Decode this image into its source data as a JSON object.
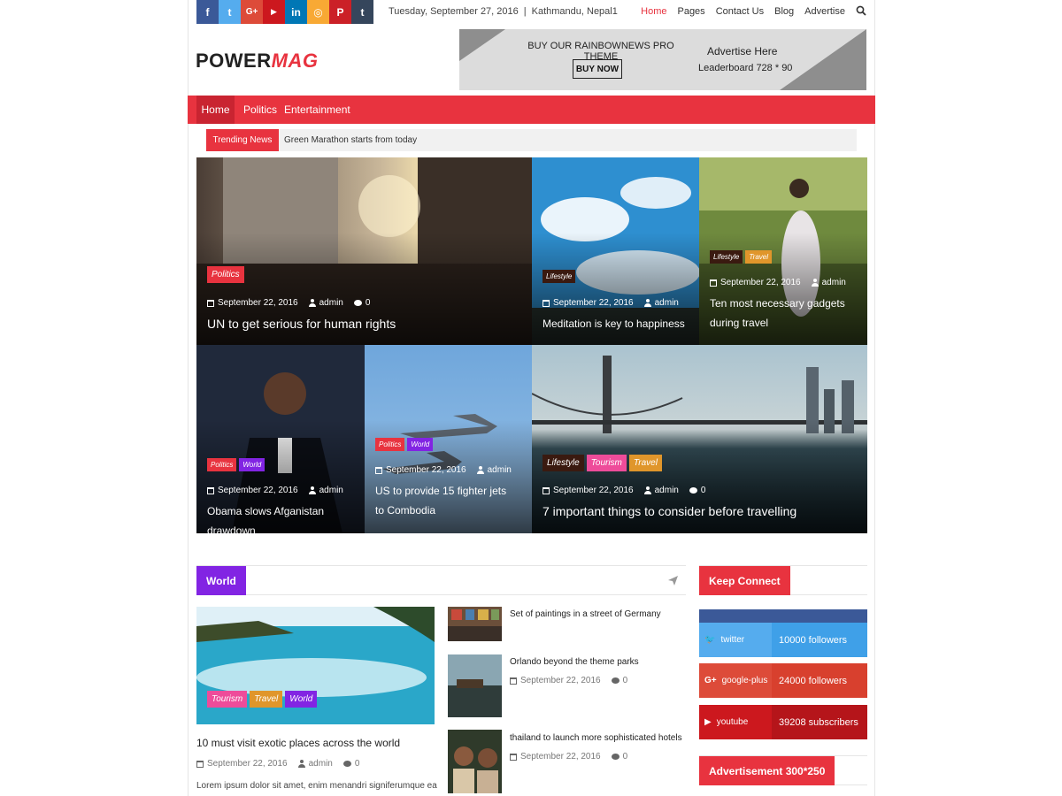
{
  "topbar": {
    "social": [
      "f",
      "t",
      "G+",
      "▶",
      "in",
      "◎",
      "P",
      "t"
    ],
    "social_colors": [
      "#3b5998",
      "#55acee",
      "#dd4b39",
      "#cc181e",
      "#0077b5",
      "#f8a934",
      "#cb2027",
      "#35465c"
    ],
    "date": "Tuesday, September 27, 2016",
    "separator": "|",
    "location": "Kathmandu, Nepal1",
    "menu": [
      "Home",
      "Pages",
      "Contact Us",
      "Blog",
      "Advertise"
    ]
  },
  "header": {
    "logo_a": "POWER",
    "logo_b": "MAG",
    "banner": {
      "promo": "BUY OUR RAINBOWNEWS PRO THEME",
      "button": "BUY NOW",
      "advertise": "Advertise Here",
      "size": "Leaderboard 728 * 90"
    }
  },
  "nav": [
    "Home",
    "Politics",
    "Entertainment"
  ],
  "trending": {
    "label": "Trending News",
    "text": "Green Marathon starts from today"
  },
  "tiles": [
    {
      "cats": [
        "Politics"
      ],
      "date": "September 22, 2016",
      "author": "admin",
      "comments": "0",
      "title": "UN to get serious for human rights"
    },
    {
      "cats": [
        "Lifestyle"
      ],
      "date": "September 22, 2016",
      "author": "admin",
      "title": "Meditation is key to happiness"
    },
    {
      "cats": [
        "Lifestyle",
        "Travel"
      ],
      "date": "September 22, 2016",
      "author": "admin",
      "title": "Ten most necessary gadgets during travel"
    },
    {
      "cats": [
        "Politics",
        "World"
      ],
      "date": "September 22, 2016",
      "author": "admin",
      "title": "Obama slows Afganistan drawdown"
    },
    {
      "cats": [
        "Politics",
        "World"
      ],
      "date": "September 22, 2016",
      "author": "admin",
      "title": "US to provide 15 fighter jets to Combodia"
    },
    {
      "cats": [
        "Lifestyle",
        "Tourism",
        "Travel"
      ],
      "date": "September 22, 2016",
      "author": "admin",
      "comments": "0",
      "title": "7 important things to consider before travelling"
    }
  ],
  "cat_colors": {
    "Politics": "#e8333f",
    "Lifestyle": "#3a1a10",
    "Travel": "#e0962b",
    "World": "#8224e3",
    "Tourism": "#ee4c9a"
  },
  "world": {
    "label": "World",
    "featured": {
      "cats": [
        "Tourism",
        "Travel",
        "World"
      ],
      "title": "10 must visit exotic places across the world",
      "date": "September 22, 2016",
      "author": "admin",
      "comments": "0",
      "excerpt": "Lorem ipsum dolor sit amet, enim menandri signiferumque ea"
    },
    "list": [
      {
        "title": "Set of paintings in a street of Germany"
      },
      {
        "title": "Orlando beyond the theme parks",
        "date": "September 22, 2016",
        "comments": "0"
      },
      {
        "title": "thailand to launch more sophisticated hotels",
        "date": "September 22, 2016",
        "comments": "0"
      }
    ]
  },
  "keep_connect": {
    "label": "Keep Connect",
    "rows": [
      {
        "name": "twitter",
        "count": "10000 followers",
        "color_a": "#55acee",
        "color_b": "#3fa0e8"
      },
      {
        "name": "google-plus",
        "count": "24000 followers",
        "color_a": "#dd4b39",
        "color_b": "#d8402e"
      },
      {
        "name": "youtube",
        "count": "39208 subscribers",
        "color_a": "#cc181e",
        "color_b": "#b5151a"
      }
    ]
  },
  "ad_label": "Advertisement 300*250",
  "colors": {
    "accent": "#e8333f",
    "purple": "#8224e3"
  }
}
